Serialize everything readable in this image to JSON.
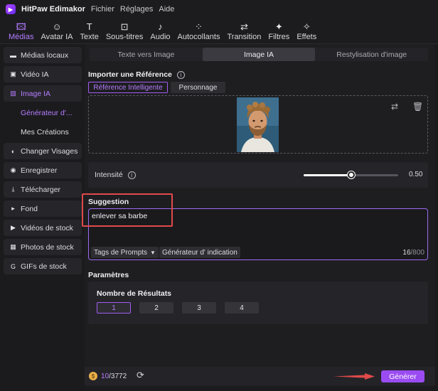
{
  "app": {
    "name": "HitPaw Edimakor",
    "menu": [
      "Fichier",
      "Réglages",
      "Aide"
    ]
  },
  "toolbar": {
    "tools": [
      {
        "label": "Médias",
        "icon": "media-icon"
      },
      {
        "label": "Avatar IA",
        "icon": "avatar-icon"
      },
      {
        "label": "Texte",
        "icon": "text-icon"
      },
      {
        "label": "Sous-titres",
        "icon": "subtitles-icon"
      },
      {
        "label": "Audio",
        "icon": "audio-icon"
      },
      {
        "label": "Autocollants",
        "icon": "stickers-icon"
      },
      {
        "label": "Transition",
        "icon": "transition-icon"
      },
      {
        "label": "Filtres",
        "icon": "filters-icon"
      },
      {
        "label": "Effets",
        "icon": "effects-icon"
      }
    ],
    "active": "Médias"
  },
  "sidebar": {
    "items": [
      {
        "label": "Médias locaux",
        "icon": "folder-icon"
      },
      {
        "label": "Vidéo IA",
        "icon": "ai-video-icon"
      },
      {
        "label": "Image IA",
        "icon": "ai-image-icon"
      },
      {
        "label": "Générateur d'...",
        "icon": ""
      },
      {
        "label": "Mes Créations",
        "icon": ""
      },
      {
        "label": "Changer Visages",
        "icon": "face-swap-icon"
      },
      {
        "label": "Enregistrer",
        "icon": "record-icon"
      },
      {
        "label": "Télécharger",
        "icon": "download-icon"
      },
      {
        "label": "Fond",
        "icon": "background-icon"
      },
      {
        "label": "Vidéos de stock",
        "icon": "stock-video-icon"
      },
      {
        "label": "Photos de stock",
        "icon": "stock-photo-icon"
      },
      {
        "label": "GIFs de stock",
        "icon": "gif-icon"
      }
    ]
  },
  "main": {
    "tabs": [
      "Texte vers Image",
      "Image IA",
      "Restylisation d'image"
    ],
    "active_tab": "Image IA",
    "reference": {
      "title": "Importer une Référence",
      "mode_smart": "Référence Intelligente",
      "mode_character": "Personnage"
    },
    "intensity": {
      "label": "Intensité",
      "value": "0.50",
      "level": 0.5
    },
    "suggestion": {
      "title": "Suggestion",
      "text": "enlever sa barbe",
      "prompt_tags": "Tags de Prompts",
      "prompt_generator": "Générateur d'  indication",
      "count": "16",
      "max": "/800"
    },
    "params": {
      "title": "Paramètres",
      "results_label": "Nombre de Résultats",
      "options": [
        "1",
        "2",
        "3",
        "4"
      ],
      "selected": "1"
    },
    "footer": {
      "credits_used": "10",
      "credits_total": "/3772",
      "generate": "Générer"
    }
  },
  "colors": {
    "accent": "#9a4cf2",
    "accent_text": "#b57cff",
    "highlight": "#e04a4a"
  }
}
